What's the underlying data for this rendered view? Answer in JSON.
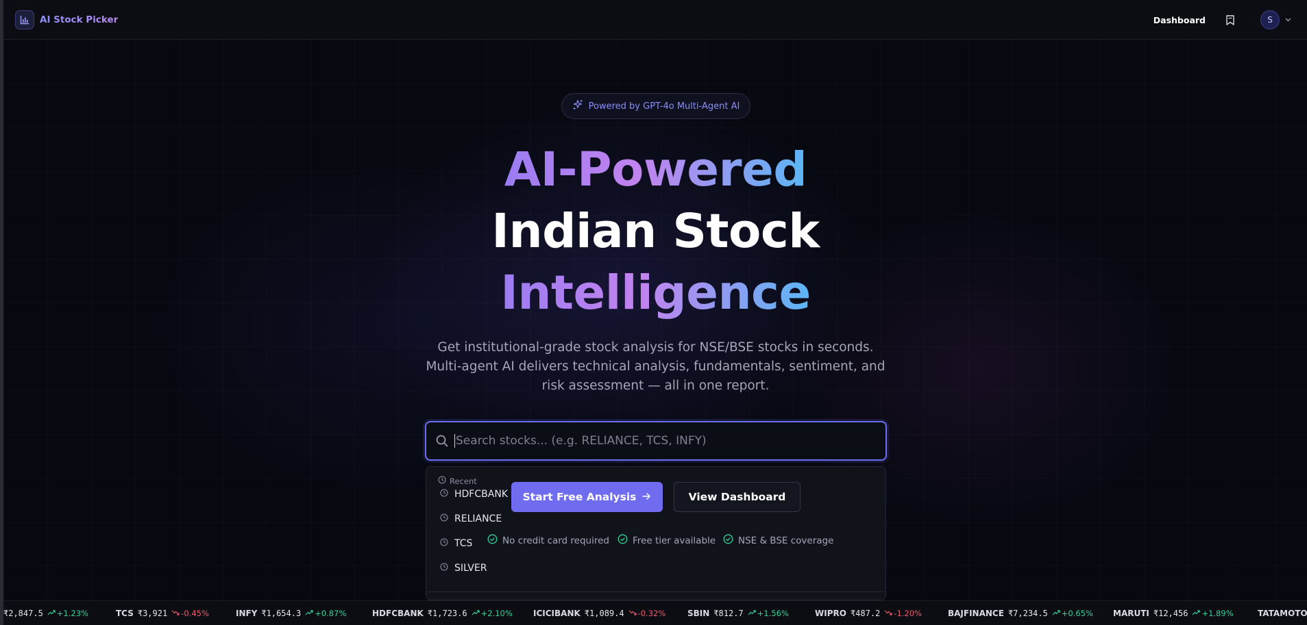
{
  "nav": {
    "brand": "AI Stock Picker",
    "dashboard_label": "Dashboard",
    "avatar_initial": "S"
  },
  "hero": {
    "badge": "Powered by GPT-4o Multi-Agent AI",
    "headline_1": "AI-Powered",
    "headline_2": "Indian Stock",
    "headline_3": "Intelligence",
    "subtitle": "Get institutional-grade stock analysis for NSE/BSE stocks in seconds. Multi-agent AI delivers technical analysis, fundamentals, sentiment, and risk assessment — all in one report."
  },
  "search": {
    "placeholder": "Search stocks... (e.g. RELIANCE, TCS, INFY)",
    "value": ""
  },
  "dropdown": {
    "recent_label": "Recent",
    "items": [
      "HDFCBANK",
      "RELIANCE",
      "TCS",
      "SILVER"
    ]
  },
  "cta": {
    "primary": "Start Free Analysis",
    "secondary": "View Dashboard"
  },
  "features": [
    "No credit card required",
    "Free tier available",
    "NSE & BSE coverage"
  ],
  "ticker": [
    {
      "symbol": "",
      "price": "₹2,847.5",
      "change": "+1.23%",
      "direction": "up"
    },
    {
      "symbol": "TCS",
      "price": "₹3,921",
      "change": "-0.45%",
      "direction": "down"
    },
    {
      "symbol": "INFY",
      "price": "₹1,654.3",
      "change": "+0.87%",
      "direction": "up"
    },
    {
      "symbol": "HDFCBANK",
      "price": "₹1,723.6",
      "change": "+2.10%",
      "direction": "up"
    },
    {
      "symbol": "ICICIBANK",
      "price": "₹1,089.4",
      "change": "-0.32%",
      "direction": "down"
    },
    {
      "symbol": "SBIN",
      "price": "₹812.7",
      "change": "+1.56%",
      "direction": "up"
    },
    {
      "symbol": "WIPRO",
      "price": "₹487.2",
      "change": "-1.20%",
      "direction": "down"
    },
    {
      "symbol": "BAJFINANCE",
      "price": "₹7,234.5",
      "change": "+0.65%",
      "direction": "up"
    },
    {
      "symbol": "MARUTI",
      "price": "₹12,456",
      "change": "+1.89%",
      "direction": "up"
    },
    {
      "symbol": "TATAMOTORS",
      "price": "",
      "change": "",
      "direction": "up"
    }
  ],
  "colors": {
    "accent": "#6f6cf0",
    "positive": "#34d399",
    "negative": "#f05a6a",
    "background": "#05070d"
  }
}
